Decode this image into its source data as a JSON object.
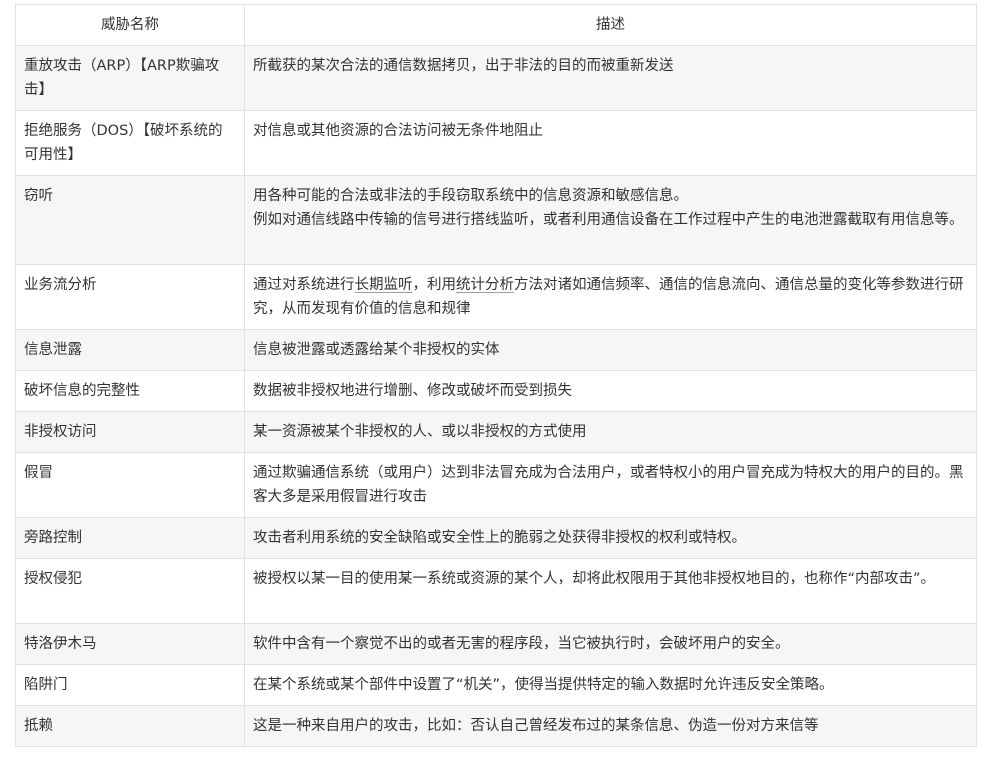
{
  "table": {
    "headers": [
      "威胁名称",
      "描述"
    ],
    "rows": [
      {
        "name": "重放攻击（ARP）【ARP欺骗攻击】",
        "desc": [
          "所截获的某次合法的通信数据拷贝，出于非法的目的而被重新发送"
        ]
      },
      {
        "name": "拒绝服务（DOS）【破坏系统的可用性】",
        "desc": [
          "对信息或其他资源的合法访问被无条件地阻止"
        ]
      },
      {
        "name": "窃听",
        "desc": [
          "用各种可能的合法或非法的手段窃取系统中的信息资源和敏感信息。",
          "例如对通信线路中传输的信号进行搭线监听，或者利用通信设备在工作过程中产生的电池泄露截取有用信息等。"
        ]
      },
      {
        "name": "业务流分析",
        "desc_parts": [
          "通过对系统进行",
          "长期监听",
          "，利用",
          "统计分析",
          "方法对诸如通信频率、通信的信息流向、通信总量的变化等参数进行研究，从而发现有价值的信息和规律"
        ]
      },
      {
        "name": "信息泄露",
        "desc": [
          "信息被泄露或透露给某个非授权的实体"
        ]
      },
      {
        "name": "破坏信息的完整性",
        "desc": [
          "数据被非授权地进行增删、修改或破坏而受到损失"
        ]
      },
      {
        "name": "非授权访问",
        "desc": [
          "某一资源被某个非授权的人、或以非授权的方式使用"
        ]
      },
      {
        "name": "假冒",
        "desc": [
          "通过欺骗通信系统（或用户）达到非法冒充成为合法用户，或者特权小的用户冒充成为特权大的用户的目的。黑客大多是采用假冒进行攻击"
        ]
      },
      {
        "name": "旁路控制",
        "desc": [
          "攻击者利用系统的安全缺陷或安全性上的脆弱之处获得非授权的权利或特权。"
        ]
      },
      {
        "name": "授权侵犯",
        "desc": [
          "被授权以某一目的使用某一系统或资源的某个人，却将此权限用于其他非授权地目的，也称作“内部攻击”。"
        ]
      },
      {
        "name": "特洛伊木马",
        "desc": [
          "软件中含有一个察觉不出的或者无害的程序段，当它被执行时，会破坏用户的安全。"
        ]
      },
      {
        "name": "陷阱门",
        "desc": [
          "在某个系统或某个部件中设置了“机关”，使得当提供特定的输入数据时允许违反安全策略。"
        ]
      },
      {
        "name": "抵赖",
        "desc": [
          "这是一种来自用户的攻击，比如：否认自己曾经发布过的某条信息、伪造一份对方来信等"
        ]
      }
    ]
  }
}
